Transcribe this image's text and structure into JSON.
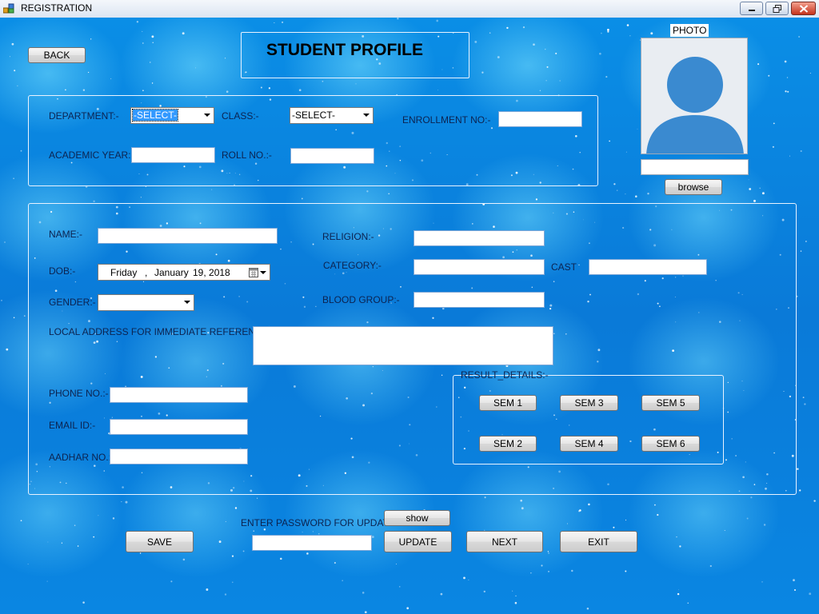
{
  "window": {
    "title": "REGISTRATION",
    "controls": [
      "minimize",
      "restore",
      "close"
    ]
  },
  "header": {
    "back_label": "BACK",
    "page_title": "STUDENT PROFILE"
  },
  "photo": {
    "label": "PHOTO",
    "path_value": "",
    "browse_label": "browse",
    "icon": "person-silhouette-icon"
  },
  "academic": {
    "department_label": "DEPARTMENT:-",
    "department_value": "-SELECT-",
    "class_label": "CLASS:-",
    "class_value": "-SELECT-",
    "enrollment_label": "ENROLLMENT NO:-",
    "enrollment_value": "",
    "academic_year_label": "ACADEMIC YEAR:-",
    "academic_year_value": "",
    "roll_label": "ROLL NO.:-",
    "roll_value": ""
  },
  "personal": {
    "name_label": "NAME:-",
    "name_value": "",
    "religion_label": "RELIGION:-",
    "religion_value": "",
    "dob_label": "DOB:-",
    "dob_day": "Friday",
    "dob_sep": ",",
    "dob_month": "January",
    "dob_date": "19, 2018",
    "category_label": "CATEGORY:-",
    "category_value": "",
    "cast_label": "CAST",
    "cast_value": "",
    "gender_label": "GENDER:-",
    "gender_value": "",
    "blood_label": "BLOOD GROUP:-",
    "blood_value": "",
    "address_label": "LOCAL ADDRESS FOR IMMEDIATE REFERENCE:-",
    "address_value": "",
    "phone_label": "PHONE NO.:-",
    "phone_value": "",
    "email_label": "EMAIL ID:-",
    "email_value": "",
    "aadhar_label": "AADHAR NO.:-",
    "aadhar_value": ""
  },
  "results": {
    "caption": "RESULT_DETAILS:-",
    "sem_buttons": [
      "SEM 1",
      "SEM 3",
      "SEM 5",
      "SEM 2",
      "SEM 4",
      "SEM 6"
    ]
  },
  "footer": {
    "password_label": "ENTER PASSWORD FOR UPDATE",
    "password_value": "",
    "show_label": "show",
    "save_label": "SAVE",
    "update_label": "UPDATE",
    "next_label": "NEXT",
    "exit_label": "EXIT"
  },
  "colors": {
    "background": "#0a86e2",
    "selection": "#3399ff",
    "panel_border": "#e8f2ff"
  }
}
